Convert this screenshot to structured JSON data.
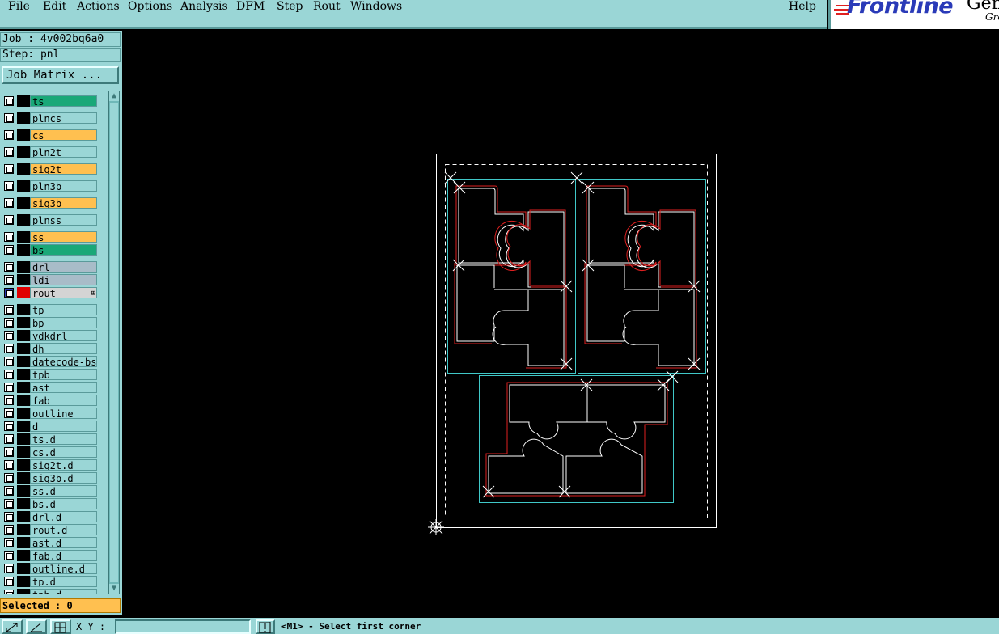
{
  "menu": {
    "items": [
      "File",
      "Edit",
      "Actions",
      "Options",
      "Analysis",
      "DFM",
      "Step",
      "Rout",
      "Windows"
    ],
    "help": "Help"
  },
  "brand": {
    "name": "Frontline",
    "product_fragment": "Gen",
    "group_fragment": "Gro"
  },
  "job": {
    "label": "Job : 4v002bq6a0"
  },
  "step": {
    "label": "Step: pnl"
  },
  "job_matrix": {
    "label": "Job Matrix ..."
  },
  "layers": [
    {
      "name": "ts",
      "color": "#1aa878"
    },
    {
      "name": "plncs",
      "color": "#9ad6d6"
    },
    {
      "name": "cs",
      "color": "#ffc050"
    },
    {
      "name": "pln2t",
      "color": "#9ad6d6"
    },
    {
      "name": "sig2t",
      "color": "#ffc050"
    },
    {
      "name": "pln3b",
      "color": "#9ad6d6"
    },
    {
      "name": "sig3b",
      "color": "#ffc050"
    },
    {
      "name": "plnss",
      "color": "#9ad6d6"
    },
    {
      "name": "ss",
      "color": "#ffc050"
    },
    {
      "name": "bs",
      "color": "#1aa878"
    },
    {
      "name": "drl",
      "color": "#a8bcc8"
    },
    {
      "name": "ldi",
      "color": "#a8bcc8"
    },
    {
      "name": "rout",
      "color": "#d4d4d4",
      "active": true
    },
    {
      "name": "tp",
      "color": "#9ad6d6"
    },
    {
      "name": "bp",
      "color": "#9ad6d6"
    },
    {
      "name": "ydkdrl",
      "color": "#9ad6d6"
    },
    {
      "name": "dh",
      "color": "#9ad6d6"
    },
    {
      "name": "datecode-bs",
      "color": "#9ad6d6"
    },
    {
      "name": "tpb",
      "color": "#9ad6d6"
    },
    {
      "name": "ast",
      "color": "#9ad6d6"
    },
    {
      "name": "fab",
      "color": "#9ad6d6"
    },
    {
      "name": "outline",
      "color": "#9ad6d6"
    },
    {
      "name": "d",
      "color": "#9ad6d6"
    },
    {
      "name": "ts.d",
      "color": "#9ad6d6"
    },
    {
      "name": "cs.d",
      "color": "#9ad6d6"
    },
    {
      "name": "sig2t.d",
      "color": "#9ad6d6"
    },
    {
      "name": "sig3b.d",
      "color": "#9ad6d6"
    },
    {
      "name": "ss.d",
      "color": "#9ad6d6"
    },
    {
      "name": "bs.d",
      "color": "#9ad6d6"
    },
    {
      "name": "drl.d",
      "color": "#9ad6d6"
    },
    {
      "name": "rout.d",
      "color": "#9ad6d6"
    },
    {
      "name": "ast.d",
      "color": "#9ad6d6"
    },
    {
      "name": "fab.d",
      "color": "#9ad6d6"
    },
    {
      "name": "outline.d",
      "color": "#9ad6d6"
    },
    {
      "name": "tp.d",
      "color": "#9ad6d6"
    },
    {
      "name": "tpb.d",
      "color": "#9ad6d6"
    }
  ],
  "selected": {
    "label": "Selected : 0"
  },
  "bottom": {
    "xy_label": "X Y :",
    "xy_value": "",
    "prompt": "<M1> - Select first corner"
  },
  "colors": {
    "panel": "#9ad6d6",
    "board_outline": "#ffffff",
    "profile": "#40c8c8",
    "rout_path": "#e02020",
    "selected_bar": "#ffc050",
    "active_layer": "#e00000"
  }
}
